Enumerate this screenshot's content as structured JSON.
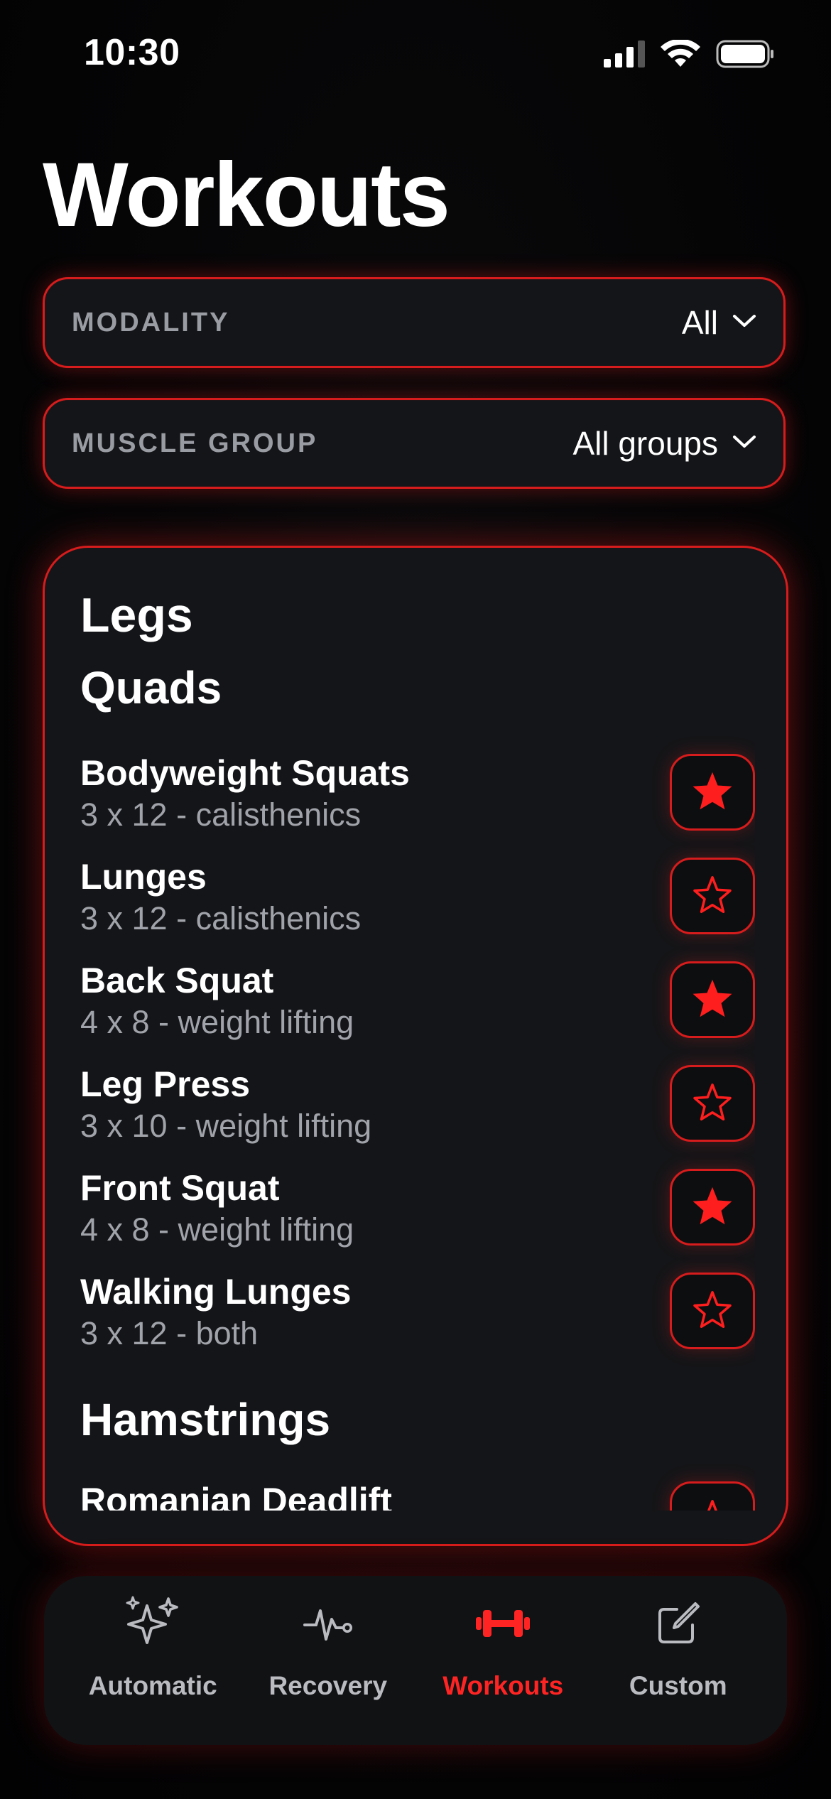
{
  "status_bar": {
    "time": "10:30"
  },
  "header": {
    "title": "Workouts"
  },
  "filters": {
    "modality": {
      "label": "MODALITY",
      "value": "All"
    },
    "muscle_group": {
      "label": "MUSCLE GROUP",
      "value": "All groups"
    }
  },
  "card": {
    "group_title": "Legs",
    "sections": [
      {
        "title": "Quads",
        "exercises": [
          {
            "name": "Bodyweight Squats",
            "detail": "3 x 12 - calisthenics",
            "favorite": true
          },
          {
            "name": "Lunges",
            "detail": "3 x 12 - calisthenics",
            "favorite": false
          },
          {
            "name": "Back Squat",
            "detail": "4 x 8 - weight lifting",
            "favorite": true
          },
          {
            "name": "Leg Press",
            "detail": "3 x 10 - weight lifting",
            "favorite": false
          },
          {
            "name": "Front Squat",
            "detail": "4 x 8 - weight lifting",
            "favorite": true
          },
          {
            "name": "Walking Lunges",
            "detail": "3 x 12 - both",
            "favorite": false
          }
        ]
      },
      {
        "title": "Hamstrings",
        "exercises": [
          {
            "name": "Romanian Deadlift",
            "detail": "",
            "favorite": false
          }
        ]
      }
    ]
  },
  "tab_bar": {
    "tabs": [
      {
        "label": "Automatic",
        "icon": "sparkles-icon",
        "active": false
      },
      {
        "label": "Recovery",
        "icon": "pulse-icon",
        "active": false
      },
      {
        "label": "Workouts",
        "icon": "dumbbell-icon",
        "active": true
      },
      {
        "label": "Custom",
        "icon": "edit-square-icon",
        "active": false
      }
    ]
  },
  "colors": {
    "accent": "#ff2424",
    "border": "#d61c1c",
    "background": "#050506",
    "card": "#141518",
    "muted_text": "#a1a3aa"
  }
}
